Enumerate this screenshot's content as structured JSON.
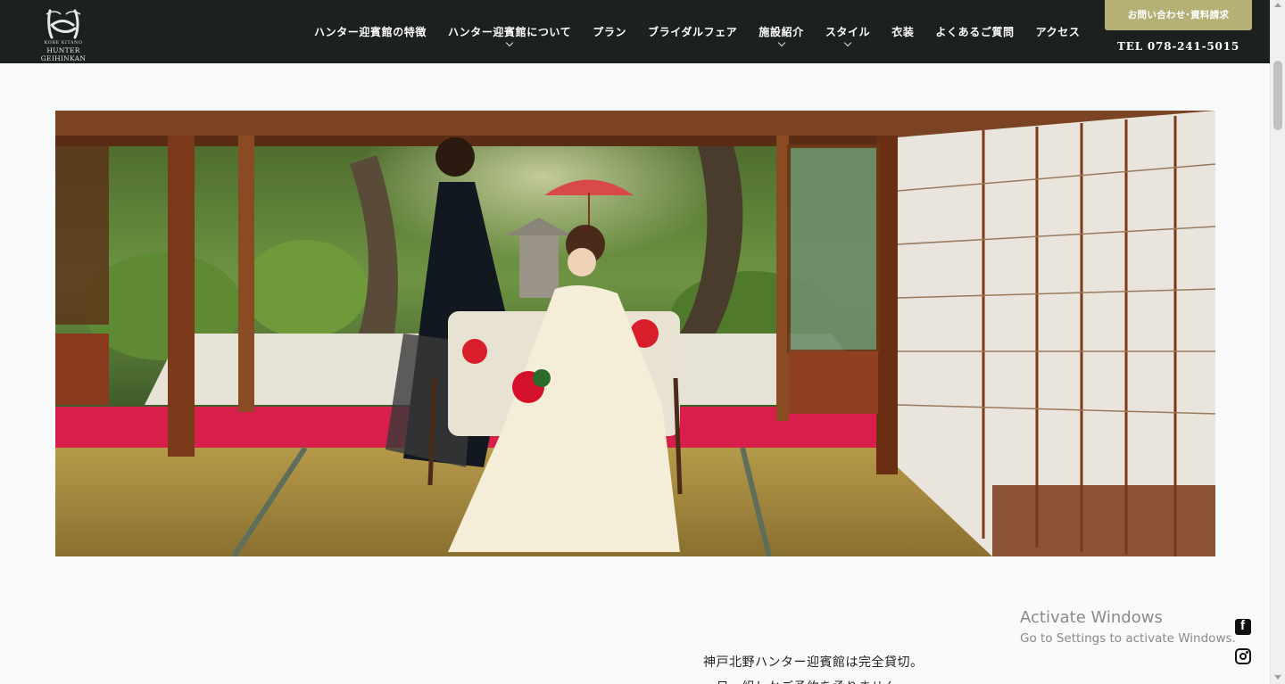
{
  "header": {
    "logo": {
      "tiny_text": "KOBE KITANO",
      "name": "HUNTER GEIHINKAN"
    },
    "nav": [
      {
        "label": "ハンター迎賓館の特徴",
        "has_dropdown": false
      },
      {
        "label": "ハンター迎賓館について",
        "has_dropdown": true
      },
      {
        "label": "プラン",
        "has_dropdown": false
      },
      {
        "label": "ブライダルフェア",
        "has_dropdown": false
      },
      {
        "label": "施設紹介",
        "has_dropdown": true
      },
      {
        "label": "スタイル",
        "has_dropdown": true
      },
      {
        "label": "衣装",
        "has_dropdown": false
      },
      {
        "label": "よくあるご質問",
        "has_dropdown": false
      },
      {
        "label": "アクセス",
        "has_dropdown": false
      }
    ],
    "cta_label": "お問い合わせ･資料請求",
    "tel": "TEL 078-241-5015"
  },
  "intro": {
    "line1": "神戸北野ハンター迎賓館は完全貸切。",
    "line2": "一日一組しかご予約を承りません。"
  },
  "social": {
    "facebook_glyph": "f"
  },
  "os_overlay": {
    "title": "Activate Windows",
    "subtitle": "Go to Settings to activate Windows."
  },
  "colors": {
    "header_bg": "#1c2120",
    "cta_bg": "#b4b076",
    "page_bg": "#f8f9f9"
  }
}
